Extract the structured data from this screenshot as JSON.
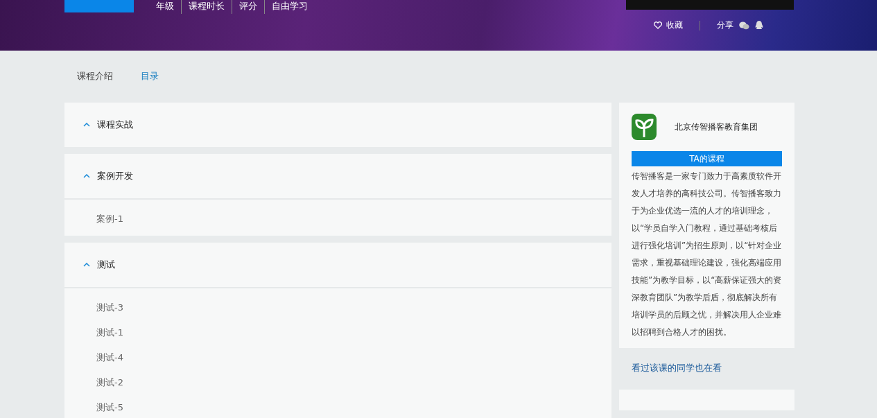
{
  "header": {
    "nav": [
      "年级",
      "课程时长",
      "评分",
      "自由学习"
    ],
    "actions": [
      {
        "kind": "favorite",
        "label": "收藏"
      },
      {
        "kind": "share",
        "label": "分享"
      }
    ]
  },
  "tabs": [
    {
      "label": "课程介绍",
      "selected": false
    },
    {
      "label": "目录",
      "selected": true
    }
  ],
  "chapters": [
    {
      "title": "课程实战",
      "expanded": true
    },
    {
      "title": "案例开发",
      "expanded": true,
      "lessons": [
        "案例-1"
      ]
    },
    {
      "title": "测试",
      "expanded": true,
      "lessons": [
        "测试-3",
        "测试-1",
        "测试-4",
        "测试-2",
        "测试-5"
      ]
    }
  ],
  "teacher": {
    "name": "北京传智播客教育集团",
    "button": "TA的课程",
    "intro": "传智播客是一家专门致力于高素质软件开发人才培养的高科技公司。传智播客致力于为企业优选一流的人才的培训理念，以“学员自学入门教程，通过基础考核后进行强化培训”为招生原则，以“针对企业需求，重视基础理论建设，强化高端应用技能”为教学目标，以“高薪保证强大的资深教育团队”为教学后盾，彻底解决所有培训学员的后顾之忧，并解决用人企业难以招聘到合格人才的困扰。"
  },
  "related": {
    "title": "看过该课的同学也在看"
  }
}
